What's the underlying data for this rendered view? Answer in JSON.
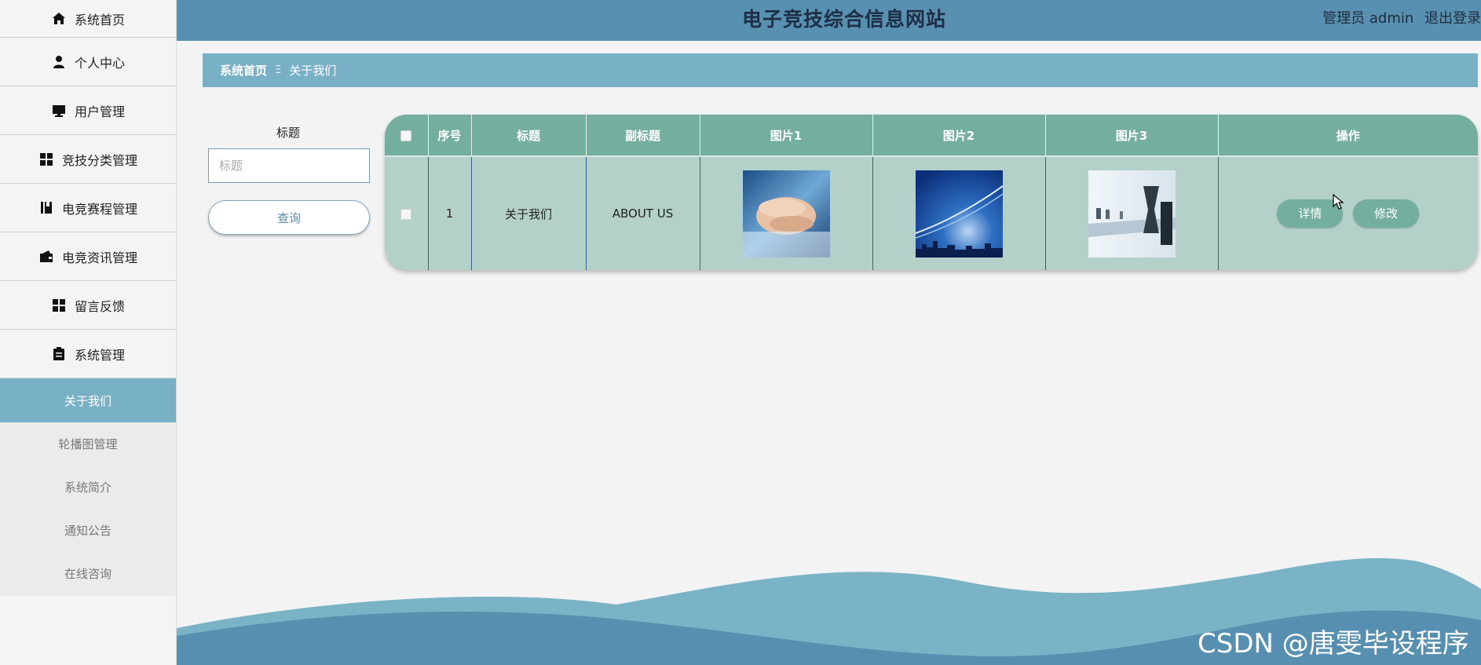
{
  "sidebar": {
    "items": [
      {
        "label": "系统首页",
        "icon": "home-icon"
      },
      {
        "label": "个人中心",
        "icon": "person-icon"
      },
      {
        "label": "用户管理",
        "icon": "monitor-icon"
      },
      {
        "label": "竞技分类管理",
        "icon": "grid-icon"
      },
      {
        "label": "电竞赛程管理",
        "icon": "book-icon"
      },
      {
        "label": "电竞资讯管理",
        "icon": "wallet-icon"
      },
      {
        "label": "留言反馈",
        "icon": "grid-icon"
      },
      {
        "label": "系统管理",
        "icon": "clipboard-icon"
      }
    ],
    "active_sub": "关于我们",
    "sub_items": [
      "轮播图管理",
      "系统简介",
      "通知公告",
      "在线咨询"
    ]
  },
  "header": {
    "title": "电子竞技综合信息网站",
    "user": "管理员 admin",
    "logout": "退出登录"
  },
  "breadcrumb": {
    "home": "系统首页",
    "separator": "Ξ",
    "current": "关于我们"
  },
  "search": {
    "label": "标题",
    "placeholder": "标题",
    "button": "查询"
  },
  "table": {
    "columns": [
      "序号",
      "标题",
      "副标题",
      "图片1",
      "图片2",
      "图片3",
      "操作"
    ],
    "rows": [
      {
        "index": "1",
        "title": "关于我们",
        "subtitle": "ABOUT US",
        "image1": "stacked-hands-image",
        "image2": "blue-abstract-city-image",
        "image3": "meeting-room-hourglass-image",
        "actions": [
          "详情",
          "修改"
        ]
      }
    ]
  },
  "watermark": "CSDN @唐雯毕设程序",
  "colors": {
    "header": "#5890b1",
    "breadcrumb": "#78b1c6",
    "table_header": "#74ae9e",
    "table_body": "#b3d1c8",
    "active_sub": "#78b1c6"
  }
}
